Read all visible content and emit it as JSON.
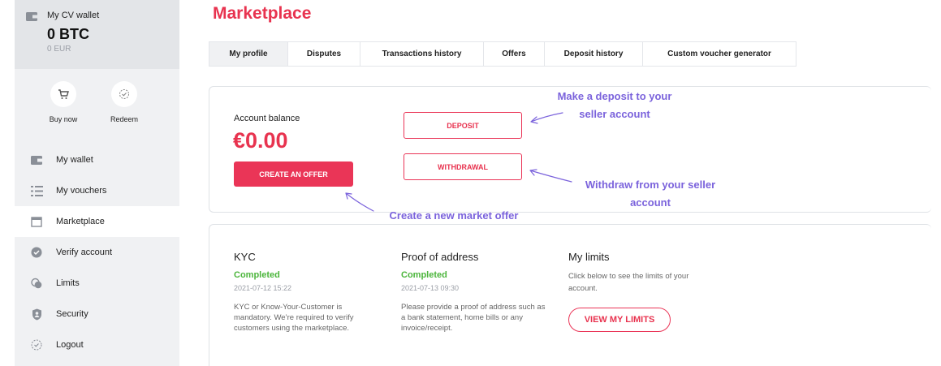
{
  "wallet": {
    "title": "My CV wallet",
    "btc": "0 BTC",
    "eur": "0 EUR"
  },
  "quick_actions": {
    "buy": "Buy now",
    "redeem": "Redeem"
  },
  "nav": [
    {
      "label": "My wallet",
      "icon": "wallet-icon"
    },
    {
      "label": "My vouchers",
      "icon": "list-icon"
    },
    {
      "label": "Marketplace",
      "icon": "store-icon"
    },
    {
      "label": "Verify account",
      "icon": "verified-badge-icon"
    },
    {
      "label": "Limits",
      "icon": "coins-icon"
    },
    {
      "label": "Security",
      "icon": "shield-icon"
    },
    {
      "label": "Logout",
      "icon": "logout-icon"
    }
  ],
  "page": {
    "title": "Marketplace"
  },
  "tabs": [
    "My profile",
    "Disputes",
    "Transactions history",
    "Offers",
    "Deposit history",
    "Custom voucher generator"
  ],
  "balance": {
    "label": "Account balance",
    "value": "€0.00",
    "create_offer": "CREATE AN OFFER",
    "deposit": "DEPOSIT",
    "withdrawal": "WITHDRAWAL"
  },
  "annotations": {
    "deposit_line1": "Make a deposit to your",
    "deposit_line2": "seller account",
    "withdraw_line1": "Withdraw from your seller",
    "withdraw_line2": "account",
    "create": "Create a new market offer"
  },
  "kyc": {
    "title": "KYC",
    "status": "Completed",
    "date": "2021-07-12 15:22",
    "desc": "KYC or Know-Your-Customer is mandatory. We’re required to verify customers using the marketplace."
  },
  "address": {
    "title": "Proof of address",
    "status": "Completed",
    "date": "2021-07-13 09:30",
    "desc": "Please provide a proof of address such as a bank statement, home bills or any invoice/receipt."
  },
  "limits": {
    "title": "My limits",
    "desc": "Click below to see the limits of your account.",
    "button": "VIEW MY LIMITS"
  },
  "colors": {
    "accent": "#e8334f",
    "annotation": "#7b63dc",
    "success": "#4bb53b",
    "sidebar": "#f0f1f3"
  }
}
